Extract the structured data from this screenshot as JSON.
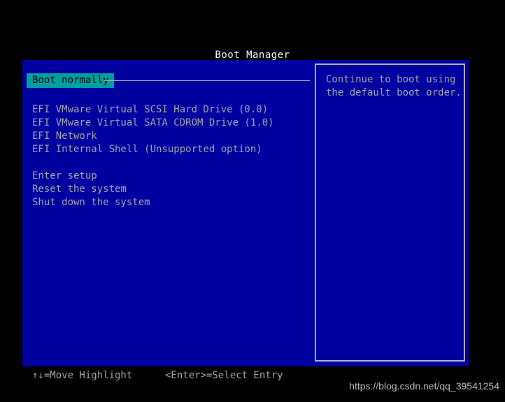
{
  "window": {
    "title": "Boot Manager",
    "background_color": "#000000",
    "panel_color": "#0000a0",
    "text_color": "#a8a8a8",
    "highlight_bg_color": "#00a0a0",
    "highlight_fg_color": "#000000",
    "border_color": "#b8b8b0",
    "title_color": "#ffffff"
  },
  "menu": {
    "selected_item": {
      "label": "Boot normally"
    },
    "boot_devices": [
      {
        "label": "EFI VMware Virtual SCSI Hard Drive (0.0)"
      },
      {
        "label": "EFI VMware Virtual SATA CDROM Drive (1.0)"
      },
      {
        "label": "EFI Network"
      },
      {
        "label": "EFI Internal Shell (Unsupported option)"
      }
    ],
    "system_actions": [
      {
        "label": "Enter setup"
      },
      {
        "label": "Reset the system"
      },
      {
        "label": "Shut down the system"
      }
    ]
  },
  "help": {
    "line1": "Continue to boot using",
    "line2": "the default boot order."
  },
  "status_bar": {
    "move_hint": "↑↓=Move Highlight",
    "select_hint": "<Enter>=Select Entry"
  },
  "watermark": {
    "text": "https://blog.csdn.net/qq_39541254"
  }
}
